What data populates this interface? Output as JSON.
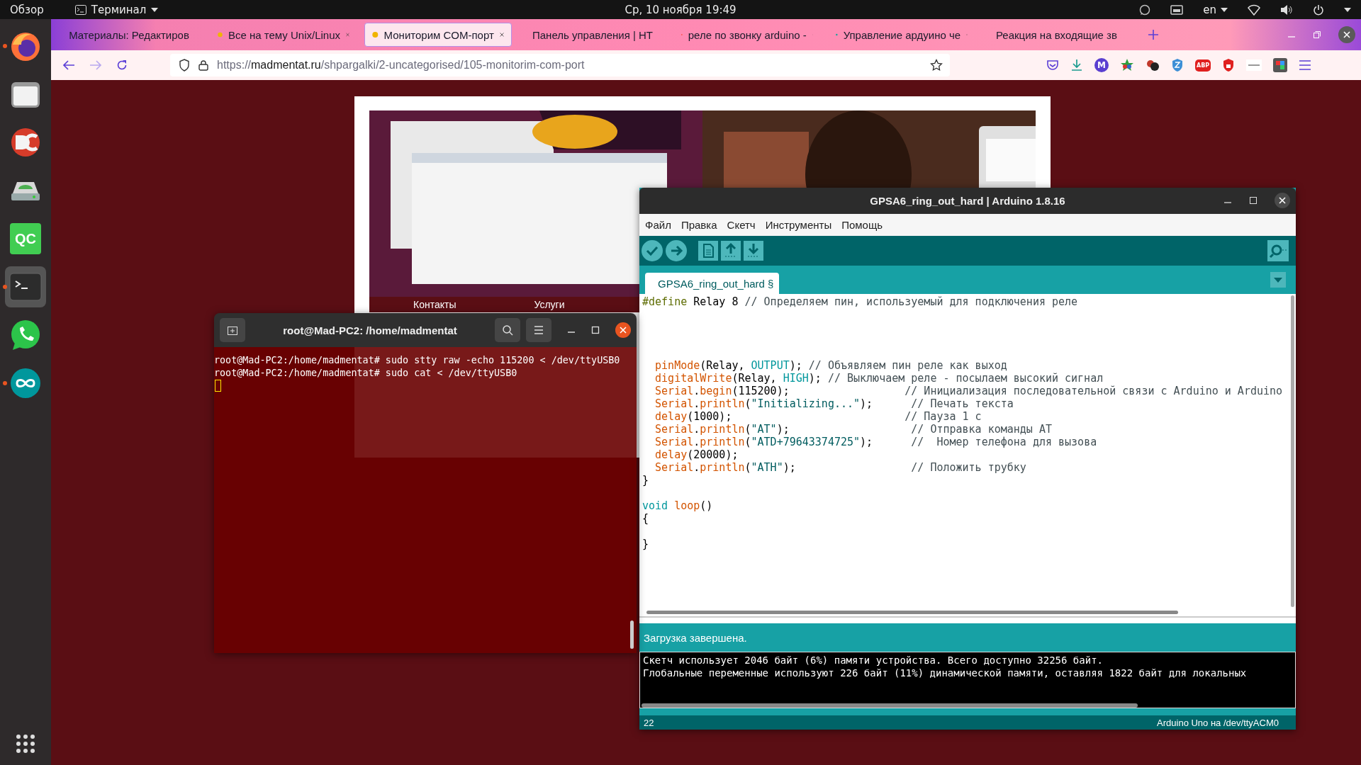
{
  "top_bar": {
    "activities": "Обзор",
    "app_menu": "Терминал",
    "clock": "Ср, 10 ноября  19:49",
    "keyboard": "en"
  },
  "dock": [
    {
      "kind": "browser",
      "running": true,
      "selected": false
    },
    {
      "kind": "files",
      "running": false,
      "selected": false
    },
    {
      "kind": "commander",
      "running": false,
      "selected": false
    },
    {
      "kind": "disk",
      "running": false,
      "selected": false
    },
    {
      "kind": "ide",
      "label": "QC",
      "running": false,
      "selected": false
    },
    {
      "kind": "terminal",
      "running": true,
      "selected": true
    },
    {
      "kind": "messenger",
      "running": false,
      "selected": false
    },
    {
      "kind": "arduino",
      "running": true,
      "selected": false
    }
  ],
  "browser": {
    "tabs": [
      {
        "label": "Материалы: Редактиров",
        "selected": false
      },
      {
        "label": "Все на тему Unix/Linux",
        "selected": false
      },
      {
        "label": "Мониторим COM-порт",
        "selected": true
      },
      {
        "label": "Панель управления | HT",
        "selected": false
      },
      {
        "label": "реле по звонку arduino -",
        "selected": false
      },
      {
        "label": "Управление ардуино че",
        "selected": false
      },
      {
        "label": "Реакция на входящие зв",
        "selected": false
      }
    ],
    "url_scheme": "https://",
    "url_host": "madmentat.ru",
    "url_path": "/shpargalki/2-uncategorised/105-monitorim-com-port",
    "extensions": [
      {
        "kind": "pocket"
      },
      {
        "kind": "download"
      },
      {
        "kind": "letter",
        "label": "M"
      },
      {
        "kind": "star"
      },
      {
        "kind": "balls"
      },
      {
        "kind": "shield"
      },
      {
        "kind": "stop",
        "label": "ABP"
      },
      {
        "kind": "lock"
      },
      {
        "kind": "strip"
      },
      {
        "kind": "tile"
      }
    ],
    "page": {
      "picture": {
        "kind": "picture"
      },
      "nav": [
        "Контакты",
        "Услуги"
      ]
    }
  },
  "terminal": {
    "title": "root@Mad-PC2: /home/madmentat",
    "lines": [
      "root@Mad-PC2:/home/madmentat# sudo stty raw -echo 115200 < /dev/ttyUSB0",
      "root@Mad-PC2:/home/madmentat# sudo cat < /dev/ttyUSB0"
    ]
  },
  "arduino": {
    "title": "GPSA6_ring_out_hard | Arduino 1.8.16",
    "menu": [
      "Файл",
      "Правка",
      "Скетч",
      "Инструменты",
      "Помощь"
    ],
    "sketch_tab": "GPSA6_ring_out_hard §",
    "code": [
      {
        "kind": "code",
        "indent": false,
        "segments": [
          {
            "text": "#define",
            "kind": "directive"
          },
          {
            "text": " Relay 8 ",
            "kind": "plain"
          },
          {
            "text": "// Определяем пин, используемый для подключения реле",
            "kind": "comment"
          }
        ]
      },
      {
        "kind": "blank"
      },
      {
        "kind": "blank"
      },
      {
        "kind": "blank"
      },
      {
        "kind": "blank"
      },
      {
        "kind": "code",
        "indent": true,
        "segments": [
          {
            "text": "pinMode",
            "kind": "func"
          },
          {
            "text": "(Relay, ",
            "kind": "plain"
          },
          {
            "text": "OUTPUT",
            "kind": "const"
          },
          {
            "text": "); ",
            "kind": "plain"
          },
          {
            "text": "// Объявляем пин реле как выход",
            "kind": "comment"
          }
        ]
      },
      {
        "kind": "code",
        "indent": true,
        "segments": [
          {
            "text": "digitalWrite",
            "kind": "func"
          },
          {
            "text": "(Relay, ",
            "kind": "plain"
          },
          {
            "text": "HIGH",
            "kind": "const"
          },
          {
            "text": "); ",
            "kind": "plain"
          },
          {
            "text": "// Выключаем реле - посылаем высокий сигнал",
            "kind": "comment"
          }
        ]
      },
      {
        "kind": "code",
        "indent": true,
        "segments": [
          {
            "text": "Serial",
            "kind": "func"
          },
          {
            "text": ".",
            "kind": "plain"
          },
          {
            "text": "begin",
            "kind": "func"
          },
          {
            "text": "(115200);                  ",
            "kind": "plain"
          },
          {
            "text": "// Инициализация последовательной связи с Arduino и Arduino",
            "kind": "comment"
          }
        ]
      },
      {
        "kind": "code",
        "indent": true,
        "segments": [
          {
            "text": "Serial",
            "kind": "func"
          },
          {
            "text": ".",
            "kind": "plain"
          },
          {
            "text": "println",
            "kind": "func"
          },
          {
            "text": "(",
            "kind": "plain"
          },
          {
            "text": "\"Initializing...\"",
            "kind": "string"
          },
          {
            "text": ");      ",
            "kind": "plain"
          },
          {
            "text": "// Печать текста",
            "kind": "comment"
          }
        ]
      },
      {
        "kind": "code",
        "indent": true,
        "segments": [
          {
            "text": "delay",
            "kind": "func"
          },
          {
            "text": "(1000);                           ",
            "kind": "plain"
          },
          {
            "text": "// Пауза 1 с",
            "kind": "comment"
          }
        ]
      },
      {
        "kind": "code",
        "indent": true,
        "segments": [
          {
            "text": "Serial",
            "kind": "func"
          },
          {
            "text": ".",
            "kind": "plain"
          },
          {
            "text": "println",
            "kind": "func"
          },
          {
            "text": "(",
            "kind": "plain"
          },
          {
            "text": "\"AT\"",
            "kind": "string"
          },
          {
            "text": ");                   ",
            "kind": "plain"
          },
          {
            "text": "// Отправка команды AT",
            "kind": "comment"
          }
        ]
      },
      {
        "kind": "code",
        "indent": true,
        "segments": [
          {
            "text": "Serial",
            "kind": "func"
          },
          {
            "text": ".",
            "kind": "plain"
          },
          {
            "text": "println",
            "kind": "func"
          },
          {
            "text": "(",
            "kind": "plain"
          },
          {
            "text": "\"ATD+79643374725\"",
            "kind": "string"
          },
          {
            "text": ");      ",
            "kind": "plain"
          },
          {
            "text": "//  Номер телефона для вызова",
            "kind": "comment"
          }
        ]
      },
      {
        "kind": "code",
        "indent": true,
        "segments": [
          {
            "text": "delay",
            "kind": "func"
          },
          {
            "text": "(20000);",
            "kind": "plain"
          }
        ]
      },
      {
        "kind": "code",
        "indent": true,
        "segments": [
          {
            "text": "Serial",
            "kind": "func"
          },
          {
            "text": ".",
            "kind": "plain"
          },
          {
            "text": "println",
            "kind": "func"
          },
          {
            "text": "(",
            "kind": "plain"
          },
          {
            "text": "\"ATH\"",
            "kind": "string"
          },
          {
            "text": ");                  ",
            "kind": "plain"
          },
          {
            "text": "// Положить трубку",
            "kind": "comment"
          }
        ]
      },
      {
        "kind": "code",
        "indent": false,
        "segments": [
          {
            "text": "}",
            "kind": "plain"
          }
        ]
      },
      {
        "kind": "blank"
      },
      {
        "kind": "code",
        "indent": false,
        "segments": [
          {
            "text": "void ",
            "kind": "const"
          },
          {
            "text": "loop",
            "kind": "func"
          },
          {
            "text": "()",
            "kind": "plain"
          }
        ]
      },
      {
        "kind": "code",
        "indent": false,
        "segments": [
          {
            "text": "{",
            "kind": "plain"
          }
        ]
      },
      {
        "kind": "blank"
      },
      {
        "kind": "code",
        "indent": false,
        "segments": [
          {
            "text": "}",
            "kind": "plain"
          }
        ]
      }
    ],
    "status": "Загрузка завершена.",
    "console": [
      "Скетч использует 2046 байт (6%) памяти устройства. Всего доступно 32256 байт.",
      "Глобальные переменные используют 226 байт (11%) динамической памяти, оставляя 1822 байт для локальных"
    ],
    "line_number": "22",
    "board": "Arduino Uno на /dev/ttyACM0"
  }
}
